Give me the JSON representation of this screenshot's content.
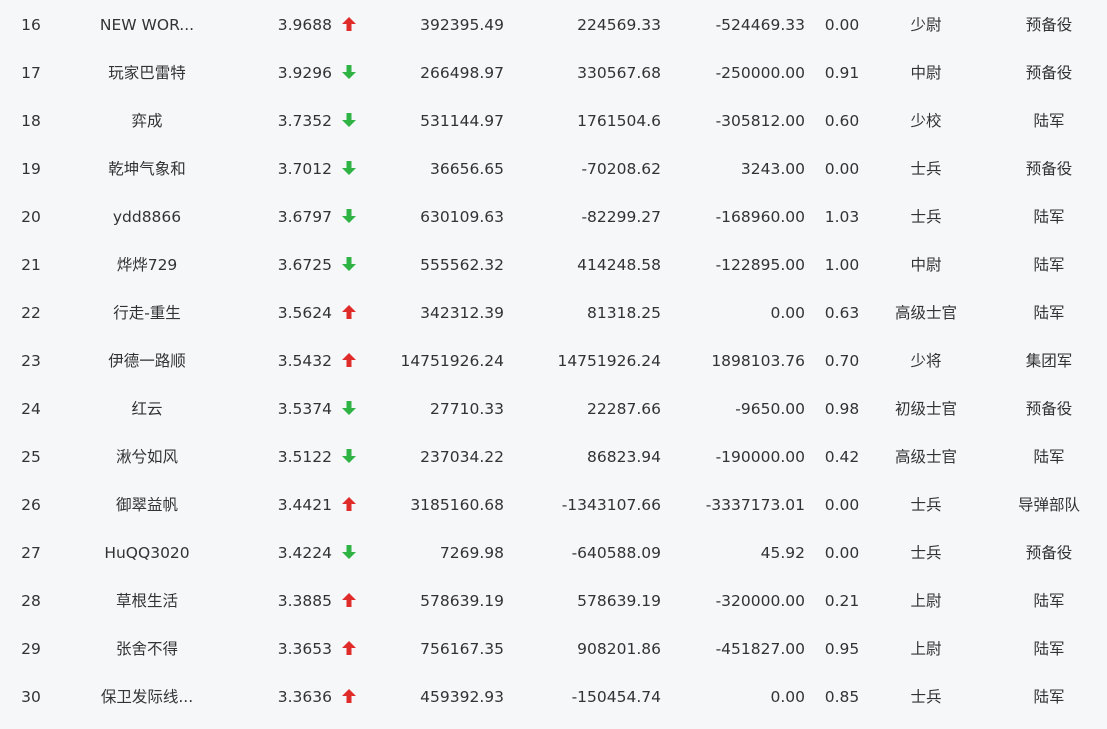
{
  "colors": {
    "up": "#e02b2b",
    "down": "#2fb344"
  },
  "rows": [
    {
      "rank": "16",
      "name": "NEW WOR...",
      "score": "3.9688",
      "trend": "up",
      "v1": "392395.49",
      "v2": "224569.33",
      "v3": "-524469.33",
      "ratio": "0.00",
      "title": "少尉",
      "unit": "预备役"
    },
    {
      "rank": "17",
      "name": "玩家巴雷特",
      "score": "3.9296",
      "trend": "down",
      "v1": "266498.97",
      "v2": "330567.68",
      "v3": "-250000.00",
      "ratio": "0.91",
      "title": "中尉",
      "unit": "预备役"
    },
    {
      "rank": "18",
      "name": "弈成",
      "score": "3.7352",
      "trend": "down",
      "v1": "531144.97",
      "v2": "1761504.6",
      "v3": "-305812.00",
      "ratio": "0.60",
      "title": "少校",
      "unit": "陆军"
    },
    {
      "rank": "19",
      "name": "乾坤气象和",
      "score": "3.7012",
      "trend": "down",
      "v1": "36656.65",
      "v2": "-70208.62",
      "v3": "3243.00",
      "ratio": "0.00",
      "title": "士兵",
      "unit": "预备役"
    },
    {
      "rank": "20",
      "name": "ydd8866",
      "score": "3.6797",
      "trend": "down",
      "v1": "630109.63",
      "v2": "-82299.27",
      "v3": "-168960.00",
      "ratio": "1.03",
      "title": "士兵",
      "unit": "陆军"
    },
    {
      "rank": "21",
      "name": "烨烨729",
      "score": "3.6725",
      "trend": "down",
      "v1": "555562.32",
      "v2": "414248.58",
      "v3": "-122895.00",
      "ratio": "1.00",
      "title": "中尉",
      "unit": "陆军"
    },
    {
      "rank": "22",
      "name": "行走-重生",
      "score": "3.5624",
      "trend": "up",
      "v1": "342312.39",
      "v2": "81318.25",
      "v3": "0.00",
      "ratio": "0.63",
      "title": "高级士官",
      "unit": "陆军"
    },
    {
      "rank": "23",
      "name": "伊德一路顺",
      "score": "3.5432",
      "trend": "up",
      "v1": "14751926.24",
      "v2": "14751926.24",
      "v3": "1898103.76",
      "ratio": "0.70",
      "title": "少将",
      "unit": "集团军"
    },
    {
      "rank": "24",
      "name": "红云",
      "score": "3.5374",
      "trend": "down",
      "v1": "27710.33",
      "v2": "22287.66",
      "v3": "-9650.00",
      "ratio": "0.98",
      "title": "初级士官",
      "unit": "预备役"
    },
    {
      "rank": "25",
      "name": "湫兮如风",
      "score": "3.5122",
      "trend": "down",
      "v1": "237034.22",
      "v2": "86823.94",
      "v3": "-190000.00",
      "ratio": "0.42",
      "title": "高级士官",
      "unit": "陆军"
    },
    {
      "rank": "26",
      "name": "御翠益帆",
      "score": "3.4421",
      "trend": "up",
      "v1": "3185160.68",
      "v2": "-1343107.66",
      "v3": "-3337173.01",
      "ratio": "0.00",
      "title": "士兵",
      "unit": "导弹部队"
    },
    {
      "rank": "27",
      "name": "HuQQ3020",
      "score": "3.4224",
      "trend": "down",
      "v1": "7269.98",
      "v2": "-640588.09",
      "v3": "45.92",
      "ratio": "0.00",
      "title": "士兵",
      "unit": "预备役"
    },
    {
      "rank": "28",
      "name": "草根生活",
      "score": "3.3885",
      "trend": "up",
      "v1": "578639.19",
      "v2": "578639.19",
      "v3": "-320000.00",
      "ratio": "0.21",
      "title": "上尉",
      "unit": "陆军"
    },
    {
      "rank": "29",
      "name": "张舍不得",
      "score": "3.3653",
      "trend": "up",
      "v1": "756167.35",
      "v2": "908201.86",
      "v3": "-451827.00",
      "ratio": "0.95",
      "title": "上尉",
      "unit": "陆军"
    },
    {
      "rank": "30",
      "name": "保卫发际线...",
      "score": "3.3636",
      "trend": "up",
      "v1": "459392.93",
      "v2": "-150454.74",
      "v3": "0.00",
      "ratio": "0.85",
      "title": "士兵",
      "unit": "陆军"
    }
  ]
}
